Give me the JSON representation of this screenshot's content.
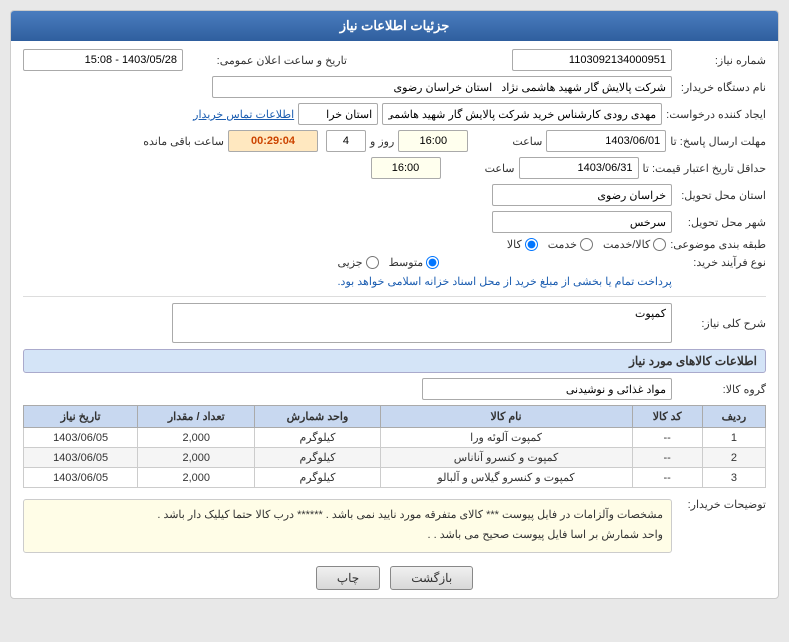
{
  "page": {
    "title": "جزئیات اطلاعات نیاز"
  },
  "fields": {
    "need_number_label": "شماره نیاز:",
    "need_number_value": "1103092134000951",
    "datetime_label": "تاریخ و ساعت اعلان عمومی:",
    "datetime_value": "1403/05/28 - 15:08",
    "buyer_label": "نام دستگاه خریدار:",
    "buyer_value": "شرکت پالایش گار شهید هاشمی نژاد   استان خراسان رضوی",
    "creator_label": "ایجاد کننده درخواست:",
    "creator_name": "مهدی رودی کارشناس خرید شرکت پالایش گار شهید هاشمی نژاد",
    "creator_province": "استان خرا",
    "creator_contact": "اطلاعات تماس خریدار",
    "answer_deadline_label": "مهلت ارسال پاسخ: تا",
    "answer_date_value": "1403/06/01",
    "answer_time_label": "ساعت",
    "answer_time_value": "16:00",
    "answer_days_label": "روز و",
    "answer_days_value": "4",
    "answer_timer_value": "00:29:04",
    "answer_timer_label": "ساعت باقی مانده",
    "price_deadline_label": "حداقل تاریخ اعتبار قیمت: تا",
    "price_date_value": "1403/06/31",
    "price_time_label": "ساعت",
    "price_time_value": "16:00",
    "delivery_province_label": "استان محل تحویل:",
    "delivery_province_value": "خراسان رضوی",
    "delivery_city_label": "شهر محل تحویل:",
    "delivery_city_value": "سرخس",
    "category_label": "طبقه بندی موضوعی:",
    "category_options": [
      "کالا",
      "خدمت",
      "کالا/خدمت"
    ],
    "category_selected": "کالا",
    "purchase_type_label": "نوع فرآیند خرید:",
    "purchase_type_options": [
      "جزیی",
      "متوسط"
    ],
    "purchase_type_selected": "متوسط",
    "purchase_note": "پرداخت تمام یا بخشی از مبلغ خرید از محل",
    "purchase_note2": "اسناد خزانه اسلامی",
    "purchase_note3": "خواهد بود.",
    "need_desc_label": "شرح کلی نیاز:",
    "need_desc_value": "کمپوت",
    "goods_section_label": "اطلاعات کالاهای مورد نیاز",
    "goods_group_label": "گروه کالا:",
    "goods_group_value": "مواد غذائی و نوشیدنی",
    "table": {
      "headers": [
        "ردیف",
        "کد کالا",
        "نام کالا",
        "واحد شمارش",
        "تعداد / مقدار",
        "تاریخ نیاز"
      ],
      "rows": [
        {
          "index": "1",
          "code": "--",
          "name": "کمپوت آلوئه ورا",
          "unit": "کیلوگرم",
          "qty": "2,000",
          "date": "1403/06/05"
        },
        {
          "index": "2",
          "code": "--",
          "name": "کمپوت و کنسرو آناناس",
          "unit": "کیلوگرم",
          "qty": "2,000",
          "date": "1403/06/05"
        },
        {
          "index": "3",
          "code": "--",
          "name": "کمپوت و کنسرو گیلاس و آلبالو",
          "unit": "کیلوگرم",
          "qty": "2,000",
          "date": "1403/06/05"
        }
      ]
    },
    "buyer_notes_label": "توضیحات خریدار:",
    "buyer_notes_line1": "مشخصات وآلزامات در فایل پیوست *** کالای متفرقه  مورد نایید نمی باشد . ******  درب کالا  حتما  کیلیک دار باشد  .",
    "buyer_notes_line2": "واحد شمارش بر اسا فایل پیوست صحیح می باشد . .",
    "btn_print": "چاپ",
    "btn_back": "بازگشت"
  }
}
